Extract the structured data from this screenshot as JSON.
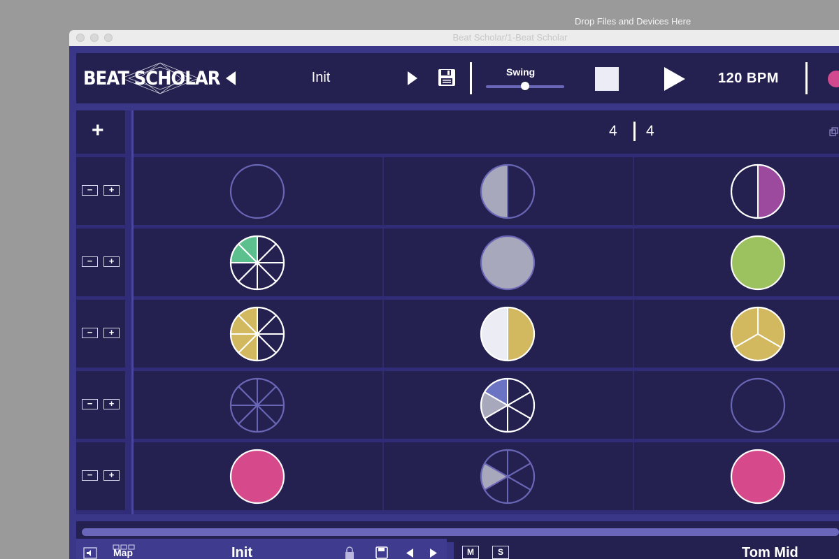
{
  "desktop": {
    "drop_label": "Drop Files and Devices Here"
  },
  "window": {
    "title": "Beat Scholar/1-Beat Scholar"
  },
  "header": {
    "logo_text": "BEAT SCHOLAR",
    "preset_name": "Init",
    "swing_label": "Swing",
    "swing_value": 0.5,
    "bpm_label": "120 BPM"
  },
  "grid": {
    "add_label": "+",
    "time_signature": {
      "numerator": "4",
      "denominator": "4"
    },
    "row_minus": "−",
    "row_plus": "+",
    "rows": [
      {
        "steps": [
          {
            "divisions": 1,
            "active": [],
            "color": "#a8a8bd",
            "outline": "dim"
          },
          {
            "divisions": 2,
            "active": [
              1
            ],
            "color": "#a8a8bd",
            "outline": "dim"
          },
          {
            "divisions": 2,
            "active": [
              0
            ],
            "color": "#9b4a9e",
            "outline": "bright"
          }
        ]
      },
      {
        "steps": [
          {
            "divisions": 8,
            "active": [
              6,
              7
            ],
            "color": "#5cc08e",
            "outline": "bright"
          },
          {
            "divisions": 1,
            "active": [
              0
            ],
            "color": "#a8a8bd",
            "outline": "dim"
          },
          {
            "divisions": 1,
            "active": [
              0
            ],
            "color": "#9cc260",
            "outline": "bright"
          }
        ]
      },
      {
        "steps": [
          {
            "divisions": 8,
            "active": [
              4,
              5,
              6,
              7
            ],
            "color": "#d2b85e",
            "outline": "bright"
          },
          {
            "divisions": 2,
            "active": [
              0
            ],
            "color": "#d2b85e",
            "outline": "bright",
            "inactive_fill": "#ececf4"
          },
          {
            "divisions": 3,
            "active": [
              0,
              1,
              2
            ],
            "color": "#d2b85e",
            "outline": "bright"
          }
        ]
      },
      {
        "steps": [
          {
            "divisions": 8,
            "active": [],
            "color": "#a8a8bd",
            "outline": "dim"
          },
          {
            "divisions": 6,
            "active": [
              5,
              4
            ],
            "color": "#6a74c2",
            "secondary": "#a8a8bd",
            "outline": "bright"
          },
          {
            "divisions": 1,
            "active": [],
            "color": "#a8a8bd",
            "outline": "dim"
          }
        ]
      },
      {
        "steps": [
          {
            "divisions": 1,
            "active": [
              0
            ],
            "color": "#d64a8c",
            "outline": "bright"
          },
          {
            "divisions": 6,
            "active": [
              4
            ],
            "color": "#a8a8bd",
            "outline": "dim"
          },
          {
            "divisions": 1,
            "active": [
              0
            ],
            "color": "#d64a8c",
            "outline": "bright"
          }
        ]
      }
    ]
  },
  "footer": {
    "map_label": "Map",
    "preset_name": "Init",
    "mute_label": "M",
    "solo_label": "S",
    "track_name": "Tom Mid"
  },
  "icons": [
    "prev-arrow-icon",
    "next-arrow-icon",
    "save-icon",
    "stop-icon",
    "play-icon",
    "copy-icon",
    "speaker-icon",
    "lock-icon",
    "record-icon"
  ]
}
